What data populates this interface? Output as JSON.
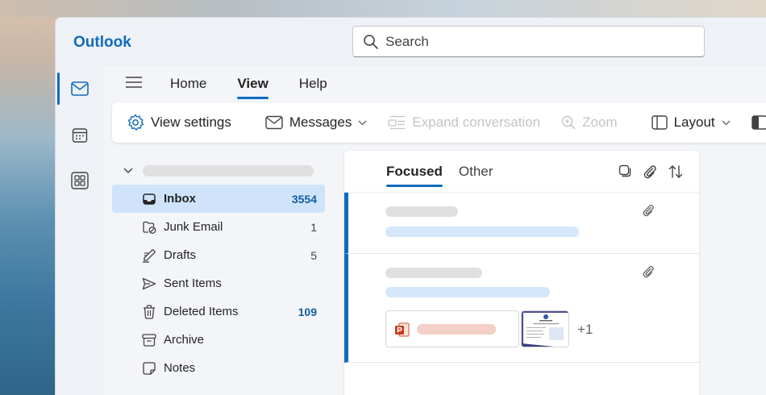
{
  "app": {
    "title": "Outlook"
  },
  "search": {
    "placeholder": "Search"
  },
  "rail": [
    {
      "name": "mail",
      "icon": "mail-icon",
      "active": true
    },
    {
      "name": "calendar",
      "icon": "calendar-icon",
      "active": false
    },
    {
      "name": "apps",
      "icon": "apps-icon",
      "active": false
    }
  ],
  "menu": {
    "tabs": [
      "Home",
      "View",
      "Help"
    ],
    "active": "View"
  },
  "ribbon": {
    "view_settings": "View settings",
    "messages": "Messages",
    "expand_conversation": "Expand conversation",
    "zoom": "Zoom",
    "layout": "Layout"
  },
  "folders": [
    {
      "label": "Inbox",
      "count": "3554",
      "icon": "inbox-icon",
      "selected": true
    },
    {
      "label": "Junk Email",
      "count": "1",
      "icon": "junk-icon",
      "selected": false
    },
    {
      "label": "Drafts",
      "count": "5",
      "icon": "drafts-icon",
      "selected": false
    },
    {
      "label": "Sent Items",
      "count": "",
      "icon": "send-icon",
      "selected": false
    },
    {
      "label": "Deleted Items",
      "count": "109",
      "icon": "trash-icon",
      "selected": false
    },
    {
      "label": "Archive",
      "count": "",
      "icon": "archive-icon",
      "selected": false
    },
    {
      "label": "Notes",
      "count": "",
      "icon": "notes-icon",
      "selected": false
    }
  ],
  "message_list": {
    "tabs": [
      "Focused",
      "Other"
    ],
    "active_tab": "Focused",
    "more_attachments": "+1"
  },
  "colors": {
    "accent": "#0f6cbd",
    "selected_bg": "#cfe4fa",
    "unread_count": "#115ea3"
  }
}
